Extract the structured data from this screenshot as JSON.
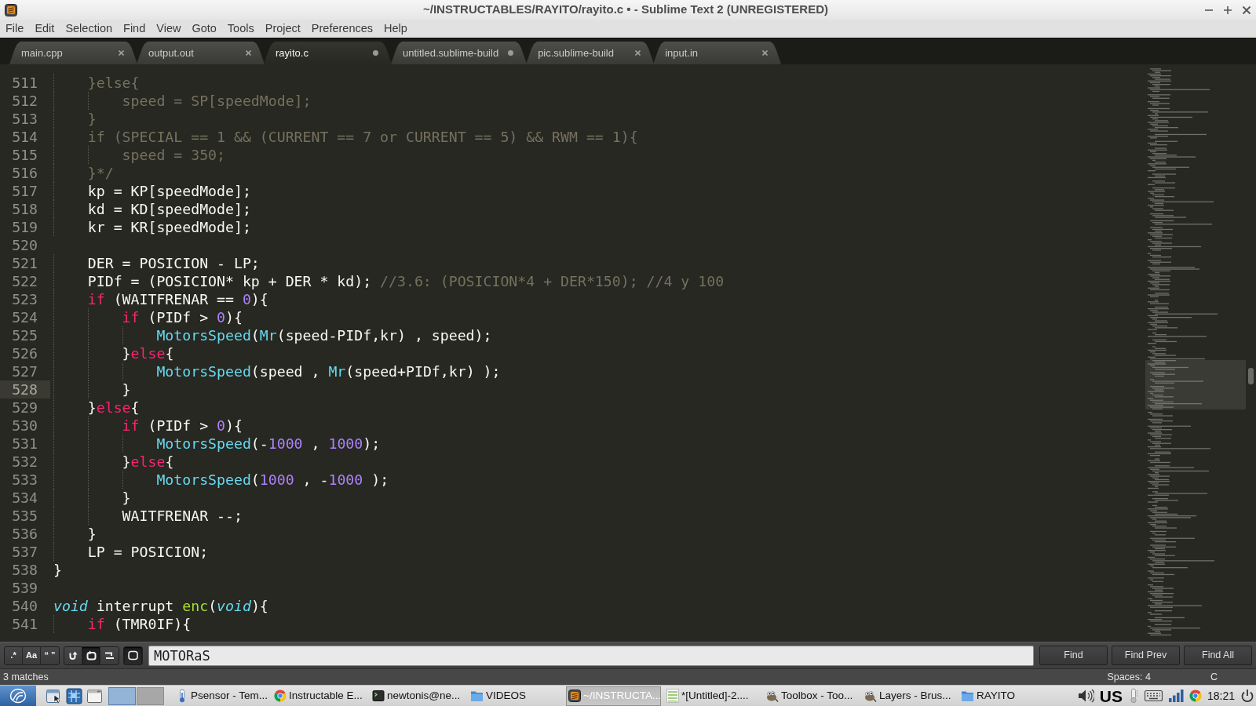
{
  "window": {
    "title": "~/INSTRUCTABLES/RAYITO/rayito.c • - Sublime Text 2 (UNREGISTERED)"
  },
  "menu": [
    "File",
    "Edit",
    "Selection",
    "Find",
    "View",
    "Goto",
    "Tools",
    "Project",
    "Preferences",
    "Help"
  ],
  "tabs": [
    {
      "label": "main.cpp",
      "selected": false,
      "dirty": false
    },
    {
      "label": "output.out",
      "selected": false,
      "dirty": false
    },
    {
      "label": "rayito.c",
      "selected": true,
      "dirty": true
    },
    {
      "label": "untitled.sublime-build",
      "selected": false,
      "dirty": true
    },
    {
      "label": "pic.sublime-build",
      "selected": false,
      "dirty": false
    },
    {
      "label": "input.in",
      "selected": false,
      "dirty": false
    }
  ],
  "editor": {
    "lines": [
      {
        "number": "511",
        "current": false,
        "tokens": [
          {
            "kind": "comment",
            "text": "    }else{"
          }
        ]
      },
      {
        "number": "512",
        "current": false,
        "tokens": [
          {
            "kind": "comment",
            "text": "        speed = SP[speedMode];"
          }
        ]
      },
      {
        "number": "513",
        "current": false,
        "tokens": [
          {
            "kind": "comment",
            "text": "    }"
          }
        ]
      },
      {
        "number": "514",
        "current": false,
        "tokens": [
          {
            "kind": "comment",
            "text": "    if (SPECIAL == 1 && (CURRENT == 7 or CURRENT == 5) && RWM == 1){"
          }
        ]
      },
      {
        "number": "515",
        "current": false,
        "tokens": [
          {
            "kind": "comment",
            "text": "        speed = 350;"
          }
        ]
      },
      {
        "number": "516",
        "current": false,
        "tokens": [
          {
            "kind": "comment",
            "text": "    }*/"
          }
        ]
      },
      {
        "number": "517",
        "current": false,
        "tokens": [
          {
            "kind": "plain",
            "text": "    kp = KP[speedMode];"
          }
        ]
      },
      {
        "number": "518",
        "current": false,
        "tokens": [
          {
            "kind": "plain",
            "text": "    kd = KD[speedMode];"
          }
        ]
      },
      {
        "number": "519",
        "current": false,
        "tokens": [
          {
            "kind": "plain",
            "text": "    kr = KR[speedMode];"
          }
        ]
      },
      {
        "number": "520",
        "current": false
      },
      {
        "number": "521",
        "current": false,
        "tokens": [
          {
            "kind": "plain",
            "text": "    DER = POSICION - LP;"
          }
        ]
      },
      {
        "number": "522",
        "current": false,
        "tokens": [
          {
            "kind": "plain",
            "text": "    PIDf = (POSICION* kp + DER * kd); "
          },
          {
            "kind": "comment",
            "text": "//3.6: (POSICION*4 + DER*150); //4 y 100"
          }
        ]
      },
      {
        "number": "523",
        "current": false,
        "tokens": [
          {
            "kind": "keyword",
            "text": "    if"
          },
          {
            "kind": "plain",
            "text": " (WAITFRENAR == "
          },
          {
            "kind": "number",
            "text": "0"
          },
          {
            "kind": "plain",
            "text": "){"
          }
        ]
      },
      {
        "number": "524",
        "current": false,
        "tokens": [
          {
            "kind": "keyword",
            "text": "        if"
          },
          {
            "kind": "plain",
            "text": " (PIDf > "
          },
          {
            "kind": "number",
            "text": "0"
          },
          {
            "kind": "plain",
            "text": "){"
          }
        ]
      },
      {
        "number": "525",
        "current": false,
        "tokens": [
          {
            "kind": "function",
            "text": "            MotorsSpeed"
          },
          {
            "kind": "plain",
            "text": "("
          },
          {
            "kind": "function",
            "text": "Mr"
          },
          {
            "kind": "plain",
            "text": "(speed-PIDf,kr) , speed);"
          }
        ]
      },
      {
        "number": "526",
        "current": false,
        "tokens": [
          {
            "kind": "plain",
            "text": "        }"
          },
          {
            "kind": "keyword",
            "text": "else"
          },
          {
            "kind": "plain",
            "text": "{"
          }
        ]
      },
      {
        "number": "527",
        "current": false,
        "tokens": [
          {
            "kind": "function",
            "text": "            MotorsSpeed"
          },
          {
            "kind": "plain",
            "text": "(speed , "
          },
          {
            "kind": "function",
            "text": "Mr"
          },
          {
            "kind": "plain",
            "text": "(speed+PIDf,kr) );"
          }
        ]
      },
      {
        "number": "528",
        "current": true,
        "tokens": [
          {
            "kind": "plain",
            "text": "        }"
          }
        ]
      },
      {
        "number": "529",
        "current": false,
        "tokens": [
          {
            "kind": "plain",
            "text": "    }"
          },
          {
            "kind": "keyword",
            "text": "else"
          },
          {
            "kind": "plain",
            "text": "{"
          }
        ]
      },
      {
        "number": "530",
        "current": false,
        "tokens": [
          {
            "kind": "keyword",
            "text": "        if"
          },
          {
            "kind": "plain",
            "text": " (PIDf > "
          },
          {
            "kind": "number",
            "text": "0"
          },
          {
            "kind": "plain",
            "text": "){"
          }
        ]
      },
      {
        "number": "531",
        "current": false,
        "tokens": [
          {
            "kind": "function",
            "text": "            MotorsSpeed"
          },
          {
            "kind": "plain",
            "text": "(-"
          },
          {
            "kind": "number",
            "text": "1000"
          },
          {
            "kind": "plain",
            "text": " , "
          },
          {
            "kind": "number",
            "text": "1000"
          },
          {
            "kind": "plain",
            "text": ");"
          }
        ]
      },
      {
        "number": "532",
        "current": false,
        "tokens": [
          {
            "kind": "plain",
            "text": "        }"
          },
          {
            "kind": "keyword",
            "text": "else"
          },
          {
            "kind": "plain",
            "text": "{"
          }
        ]
      },
      {
        "number": "533",
        "current": false,
        "tokens": [
          {
            "kind": "function",
            "text": "            MotorsSpeed"
          },
          {
            "kind": "plain",
            "text": "("
          },
          {
            "kind": "number",
            "text": "1000"
          },
          {
            "kind": "plain",
            "text": " , -"
          },
          {
            "kind": "number",
            "text": "1000"
          },
          {
            "kind": "plain",
            "text": " );"
          }
        ]
      },
      {
        "number": "534",
        "current": false,
        "tokens": [
          {
            "kind": "plain",
            "text": "        }"
          }
        ]
      },
      {
        "number": "535",
        "current": false,
        "tokens": [
          {
            "kind": "plain",
            "text": "        WAITFRENAR --;"
          }
        ]
      },
      {
        "number": "536",
        "current": false,
        "tokens": [
          {
            "kind": "plain",
            "text": "    }"
          }
        ]
      },
      {
        "number": "537",
        "current": false,
        "tokens": [
          {
            "kind": "plain",
            "text": "    LP = POSICION;"
          }
        ]
      },
      {
        "number": "538",
        "current": false,
        "tokens": [
          {
            "kind": "plain",
            "text": "}"
          }
        ]
      },
      {
        "number": "539",
        "current": false
      },
      {
        "number": "540",
        "current": false,
        "tokens": [
          {
            "kind": "storage",
            "text": "void"
          },
          {
            "kind": "plain",
            "text": " interrupt "
          },
          {
            "kind": "entity",
            "text": "enc"
          },
          {
            "kind": "plain",
            "text": "("
          },
          {
            "kind": "storage",
            "text": "void"
          },
          {
            "kind": "plain",
            "text": "){"
          }
        ]
      },
      {
        "number": "541",
        "current": false,
        "tokens": [
          {
            "kind": "keyword",
            "text": "    if"
          },
          {
            "kind": "plain",
            "text": " (TMR0IF){"
          }
        ]
      }
    ]
  },
  "find_panel": {
    "option_groups": [
      {
        "options": [
          {
            "kind": "text",
            "label": ".*",
            "on": false
          },
          {
            "kind": "text",
            "label": "Aa",
            "on": false
          },
          {
            "kind": "text",
            "label": "“ ”",
            "on": false
          }
        ]
      },
      {
        "options": [
          {
            "kind": "wrap",
            "on": false
          },
          {
            "kind": "selection",
            "on": true
          },
          {
            "kind": "highlight",
            "on": false
          }
        ]
      },
      {
        "options": [
          {
            "kind": "frame",
            "on": true
          }
        ]
      }
    ],
    "query": "MOTORaS",
    "buttons": [
      "Find",
      "Find Prev",
      "Find All"
    ]
  },
  "status_bar": {
    "message": "3 matches",
    "indentation": "Spaces: 4",
    "syntax": "C"
  },
  "taskbar": {
    "workspaces": [
      {
        "selected": true
      },
      {
        "selected": false
      }
    ],
    "tasks": [
      {
        "label": "Psensor - Tem...",
        "kind": "sensor",
        "selected": false
      },
      {
        "label": "Instructable E...",
        "kind": "browser",
        "selected": false
      },
      {
        "label": "newtonis@ne...",
        "kind": "terminal",
        "selected": false
      },
      {
        "label": "VIDEOS",
        "kind": "folder",
        "selected": false
      },
      {
        "label": "~/INSTRUCTA...",
        "kind": "editor",
        "selected": true
      },
      {
        "label": "*[Untitled]-2....",
        "kind": "image",
        "selected": false
      },
      {
        "label": "Toolbox - Too...",
        "kind": "paint",
        "selected": false
      },
      {
        "label": "Layers - Brus...",
        "kind": "paint",
        "selected": false
      },
      {
        "label": "RAYITO",
        "kind": "folder",
        "selected": false
      }
    ],
    "keyboard_layout": "US",
    "clock": "18:21"
  }
}
